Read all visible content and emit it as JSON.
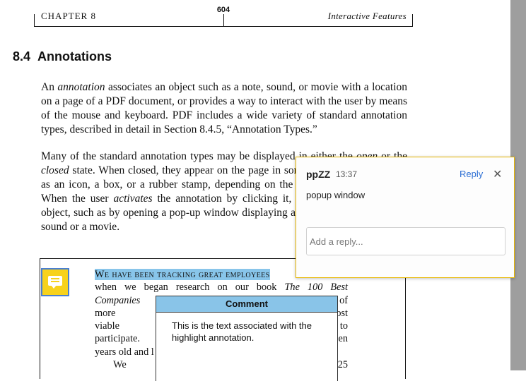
{
  "header": {
    "chapter": "CHAPTER 8",
    "page_number": "604",
    "section_name": "Interactive Features"
  },
  "section": {
    "number": "8.4",
    "title": "Annotations"
  },
  "paragraph1": {
    "t1": "An ",
    "t2": "annotation",
    "t3": " associates an object such as a note, sound, or movie with a location on a page of a PDF document, or provides a way to interact with the user by means of the mouse and keyboard. PDF includes a wide variety of standard annotation types, described in detail in Section 8.4.5, “Annotation Types.”"
  },
  "paragraph2": {
    "t1": "Many of the standard annotation types may be displayed in either the ",
    "t2": "open",
    "t3": " or the ",
    "t4": "closed",
    "t5": " state. When closed, they appear on the page in some distinctive form, such as an icon, a box, or a rubber stamp, depending on the specific annotation type. When the user ",
    "t6": "activates",
    "t7": " the annotation by clicking it, it exhibits its associated object, such as by opening a pop-up window displaying a text note or by playing a sound or a movie."
  },
  "figure": {
    "note_icon": "note-icon",
    "line1_highlight": "We have been tracking great employees",
    "line2a": "when we began research on our book ",
    "line2b": "The 100 Best",
    "line3a": "Companies to",
    "line3b": "of",
    "line4a": "more than 1,0",
    "line4b": "ost",
    "line5a": "viable candida",
    "line5b": "to",
    "line6a": "participate. (T",
    "line6b": "en",
    "line7a": "years old and l",
    "line8a": "We asked",
    "line8b": "25"
  },
  "comment_window": {
    "title": "Comment",
    "text": "This is the text associated with the highlight annotation."
  },
  "popup": {
    "author": "ppZZ",
    "time": "13:37",
    "reply_label": "Reply",
    "close_icon": "close-icon",
    "body": "popup window",
    "reply_placeholder": "Add a reply..."
  },
  "colors": {
    "highlight": "#88c5ea",
    "note_icon": "#f7d21c",
    "note_icon_border": "#4a7fd0",
    "popup_border": "#e8b700",
    "link": "#2d6fd4",
    "scroll_track": "#9e9e9e"
  }
}
